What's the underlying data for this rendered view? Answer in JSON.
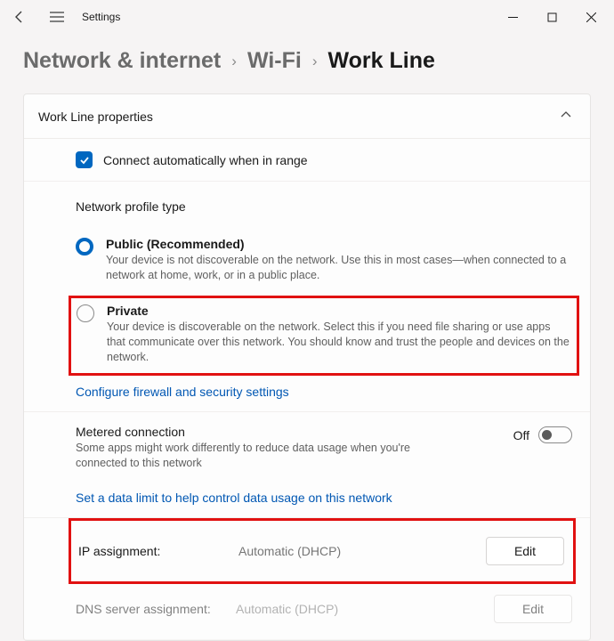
{
  "titlebar": {
    "label": "Settings"
  },
  "breadcrumb": [
    {
      "label": "Network & internet",
      "active": false
    },
    {
      "label": "Wi-Fi",
      "active": false
    },
    {
      "label": "Work Line",
      "active": true
    }
  ],
  "panel": {
    "title": "Work Line properties",
    "auto_connect": {
      "checked": true,
      "label": "Connect automatically when in range"
    },
    "profile_section_label": "Network profile type",
    "profile_options": {
      "public": {
        "title": "Public (Recommended)",
        "desc": "Your device is not discoverable on the network. Use this in most cases—when connected to a network at home, work, or in a public place.",
        "selected": true
      },
      "private": {
        "title": "Private",
        "desc": "Your device is discoverable on the network. Select this if you need file sharing or use apps that communicate over this network. You should know and trust the people and devices on the network.",
        "selected": false
      }
    },
    "firewall_link": "Configure firewall and security settings",
    "metered": {
      "title": "Metered connection",
      "desc": "Some apps might work differently to reduce data usage when you're connected to this network",
      "state_label": "Off",
      "on": false
    },
    "data_limit_link": "Set a data limit to help control data usage on this network",
    "ip_assignment": {
      "label": "IP assignment:",
      "value": "Automatic (DHCP)",
      "edit_label": "Edit"
    },
    "dns_assignment": {
      "label": "DNS server assignment:",
      "value": "Automatic (DHCP)",
      "edit_label": "Edit"
    }
  }
}
